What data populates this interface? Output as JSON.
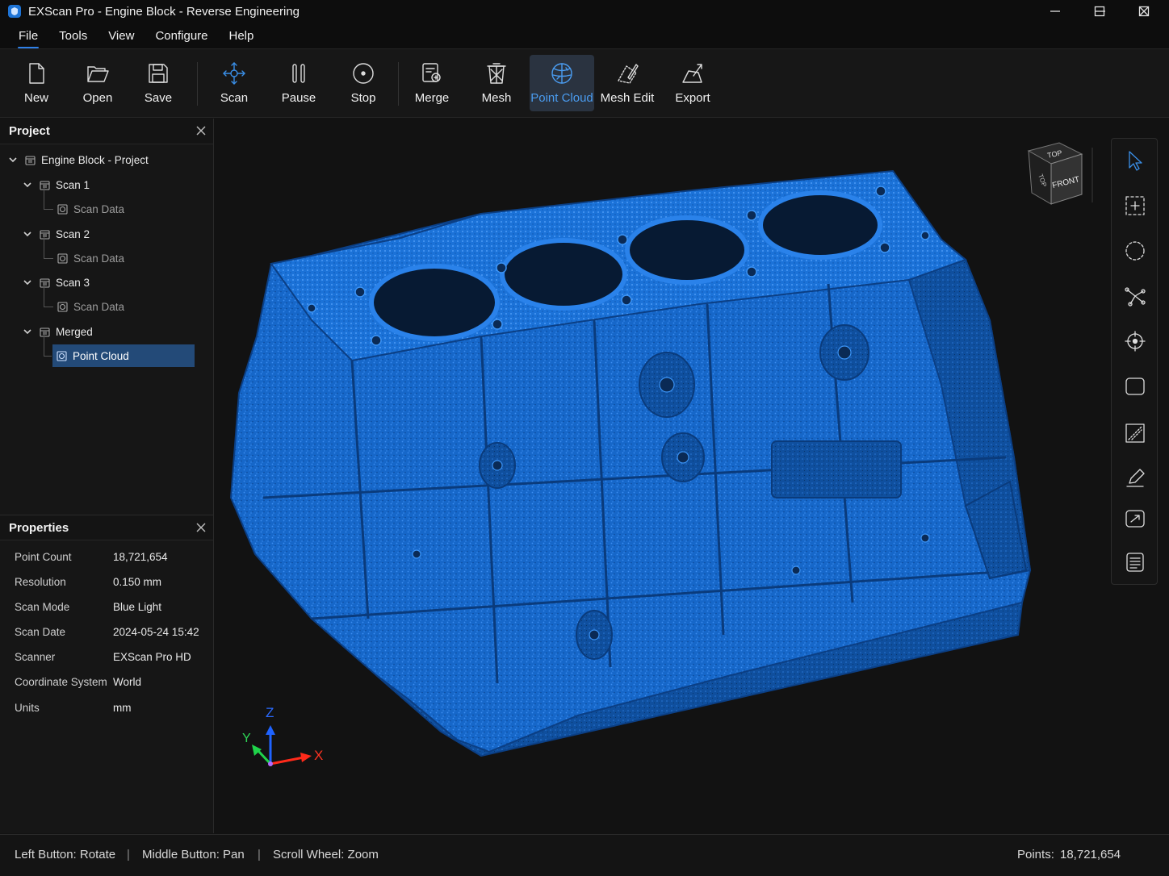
{
  "window": {
    "title": "EXScan Pro - Engine Block - Reverse Engineering"
  },
  "menu": {
    "items": [
      "File",
      "Tools",
      "View",
      "Configure",
      "Help"
    ],
    "active": "File"
  },
  "toolbar": {
    "new": "New",
    "open": "Open",
    "save": "Save",
    "scan": "Scan",
    "pause": "Pause",
    "stop": "Stop",
    "merge": "Merge",
    "mesh": "Mesh",
    "point_cloud": "Point Cloud",
    "mesh_edit": "Mesh Edit",
    "export": "Export",
    "active": "Point Cloud"
  },
  "project_panel": {
    "title": "Project",
    "tree": [
      {
        "label": "Engine Block - Project",
        "expanded": true
      },
      {
        "label": "Scan 1",
        "expanded": true
      },
      {
        "label": "Scan Data"
      },
      {
        "label": "Scan 2",
        "expanded": true
      },
      {
        "label": "Scan Data"
      },
      {
        "label": "Scan 3",
        "expanded": true
      },
      {
        "label": "Scan Data"
      },
      {
        "label": "Merged",
        "expanded": true
      },
      {
        "label": "Point Cloud",
        "selected": true
      }
    ]
  },
  "properties_panel": {
    "title": "Properties",
    "rows": [
      {
        "key": "Point Count",
        "value": "18,721,654"
      },
      {
        "key": "Resolution",
        "value": "0.150 mm"
      },
      {
        "key": "Scan Mode",
        "value": "Blue Light"
      },
      {
        "key": "Scan Date",
        "value": "2024-05-24 15:42"
      },
      {
        "key": "Scanner",
        "value": "EXScan Pro HD"
      },
      {
        "key": "Coordinate System",
        "value": "World"
      },
      {
        "key": "Units",
        "value": "mm"
      }
    ]
  },
  "viewport": {
    "view_cube": {
      "top": "TOP",
      "front": "FRONT",
      "side": "TOP"
    },
    "axes": {
      "x": "X",
      "y": "Y",
      "z": "Z"
    },
    "point_color": "#1a73e0"
  },
  "statusbar": {
    "left": "Left Button: Rotate",
    "middle": "Middle Button: Pan",
    "wheel": "Scroll Wheel: Zoom",
    "sep": "|",
    "points_label": "Points:",
    "points_value": "18,721,654"
  },
  "colors": {
    "accent": "#2f80e8",
    "selection": "#234a78",
    "background": "#121212"
  }
}
